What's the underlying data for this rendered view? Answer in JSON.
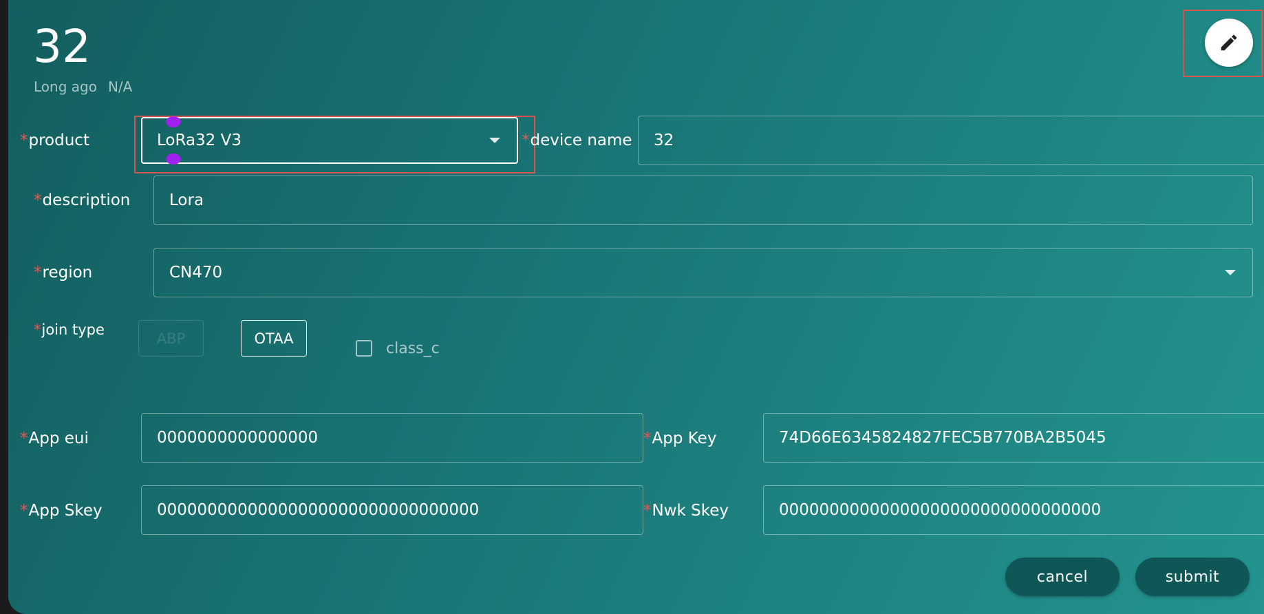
{
  "header": {
    "title": "32",
    "last_seen": "Long ago",
    "status": "N/A",
    "edit_icon": "pencil-icon"
  },
  "form": {
    "product": {
      "label": "product",
      "value": "LoRa32 V3"
    },
    "device_name": {
      "label": "device name",
      "value": "32"
    },
    "description": {
      "label": "description",
      "value": "Lora"
    },
    "region": {
      "label": "region",
      "value": "CN470"
    },
    "join_type": {
      "label": "join type",
      "options": [
        "ABP",
        "OTAA"
      ],
      "selected": "OTAA"
    },
    "class_c": {
      "label": "class_c",
      "checked": false
    },
    "app_eui": {
      "label": "App eui",
      "value": "0000000000000000"
    },
    "app_key": {
      "label": "App Key",
      "value": "74D66E6345824827FEC5B770BA2B5045"
    },
    "app_skey": {
      "label": "App Skey",
      "value": "00000000000000000000000000000000"
    },
    "nwk_skey": {
      "label": "Nwk Skey",
      "value": "00000000000000000000000000000000"
    },
    "required_marker": "*"
  },
  "actions": {
    "cancel": "cancel",
    "submit": "submit"
  },
  "colors": {
    "card_start": "#135e5f",
    "card_end": "#23948f",
    "required": "#e05a5a",
    "highlight": "#d9534f",
    "button_bg": "#0f5656"
  }
}
